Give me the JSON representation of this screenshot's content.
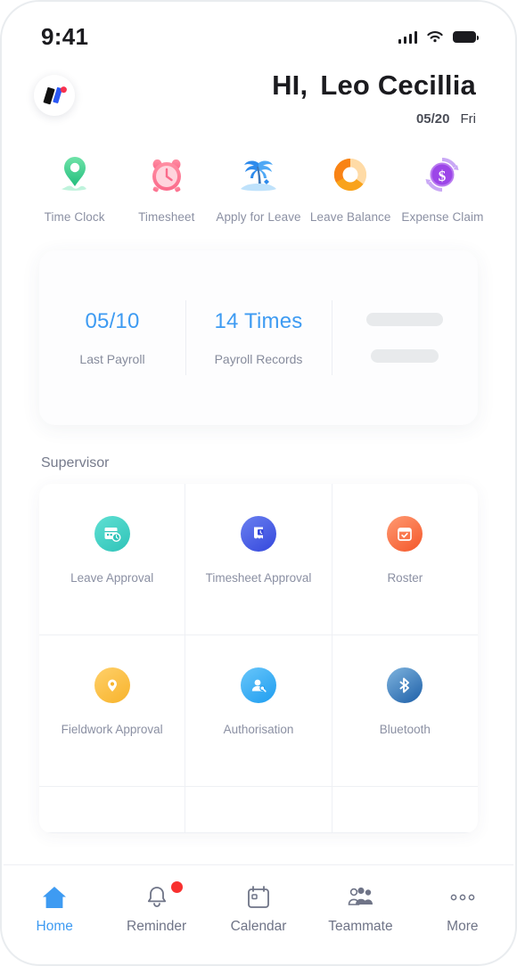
{
  "theme": {
    "accent": "#3E9BF2",
    "label": "#8B90A3",
    "badge": "#F8312F"
  },
  "status_bar": {
    "time": "9:41",
    "signal_icon": "signal-bars-icon",
    "wifi_icon": "wifi-icon",
    "battery_icon": "battery-icon"
  },
  "header": {
    "logo_icon": "app-logo-icon",
    "greeting": "HI,",
    "user_name": "Leo Cecillia",
    "date": "05/20",
    "weekday": "Fri"
  },
  "quick_actions": [
    {
      "label": "Time Clock",
      "icon": "map-pin-icon"
    },
    {
      "label": "Timesheet",
      "icon": "alarm-clock-icon"
    },
    {
      "label": "Apply for Leave",
      "icon": "palm-tree-island-icon"
    },
    {
      "label": "Leave Balance",
      "icon": "donut-chart-icon"
    },
    {
      "label": "Expense Claim",
      "icon": "dollar-refresh-icon"
    }
  ],
  "stats_card": {
    "items": [
      {
        "value": "05/10",
        "caption": "Last Payroll"
      },
      {
        "value": "14 Times",
        "caption": "Payroll Records"
      }
    ],
    "placeholder": {
      "icon": "skeleton-loading-icon"
    }
  },
  "supervisor": {
    "title": "Supervisor",
    "items": [
      {
        "label": "Leave Approval",
        "icon": "calendar-clock-icon",
        "color": "#3FD0C9"
      },
      {
        "label": "Timesheet Approval",
        "icon": "timesheet-clock-icon",
        "color": "#4A63E7"
      },
      {
        "label": "Roster",
        "icon": "calendar-check-icon",
        "color": "#FC7A4B"
      },
      {
        "label": "Fieldwork Approval",
        "icon": "pin-location-icon",
        "color": "#FBC04A"
      },
      {
        "label": "Authorisation",
        "icon": "user-key-icon",
        "color": "#36A9F5"
      },
      {
        "label": "Bluetooth",
        "icon": "bluetooth-icon",
        "color": "#2E7BC4"
      }
    ]
  },
  "tabbar": [
    {
      "label": "Home",
      "icon": "home-icon",
      "active": true,
      "badge": false
    },
    {
      "label": "Reminder",
      "icon": "bell-icon",
      "active": false,
      "badge": true
    },
    {
      "label": "Calendar",
      "icon": "calendar-icon",
      "active": false,
      "badge": false
    },
    {
      "label": "Teammate",
      "icon": "people-group-icon",
      "active": false,
      "badge": false
    },
    {
      "label": "More",
      "icon": "ellipsis-icon",
      "active": false,
      "badge": false
    }
  ]
}
